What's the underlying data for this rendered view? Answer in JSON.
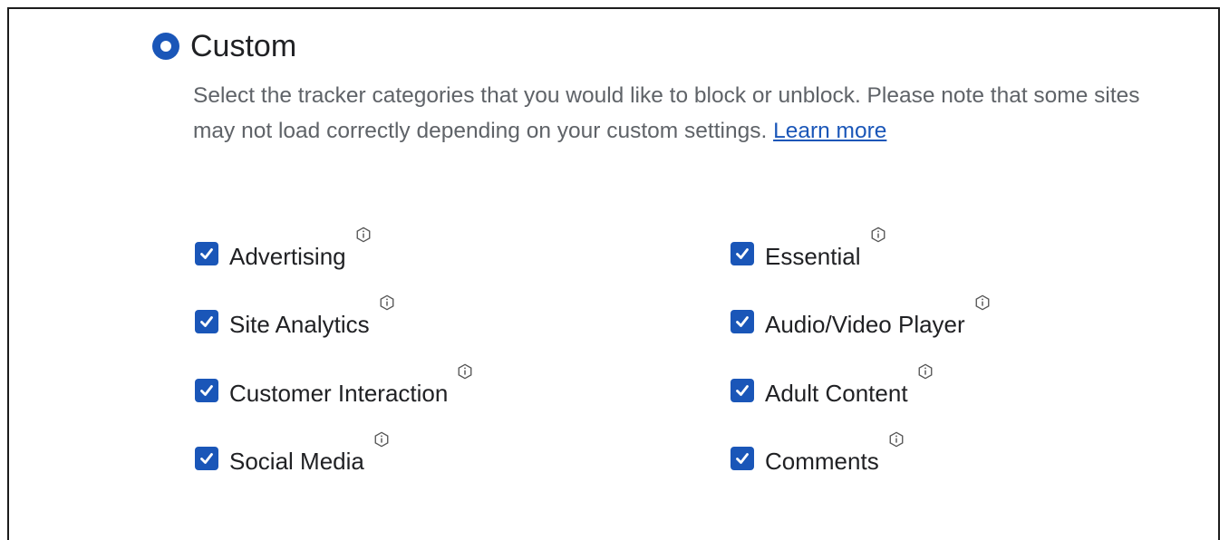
{
  "custom_option": {
    "title": "Custom",
    "selected": true
  },
  "description": {
    "text": "Select the tracker categories that you would like to block or unblock. Please note that some sites may not load correctly depending on your custom settings.",
    "link_label": "Learn more"
  },
  "colors": {
    "accent": "#1a56b8",
    "text": "#202124",
    "muted_text": "#5f6368"
  },
  "icons": {
    "checkbox": "checkmark-icon",
    "info": "info-hexagon-icon"
  },
  "categories": {
    "left": [
      {
        "label": "Advertising",
        "checked": true
      },
      {
        "label": "Site Analytics",
        "checked": true
      },
      {
        "label": "Customer Interaction",
        "checked": true
      },
      {
        "label": "Social Media",
        "checked": true
      }
    ],
    "right": [
      {
        "label": "Essential",
        "checked": true
      },
      {
        "label": "Audio/Video Player",
        "checked": true
      },
      {
        "label": "Adult Content",
        "checked": true
      },
      {
        "label": "Comments",
        "checked": true
      }
    ]
  }
}
